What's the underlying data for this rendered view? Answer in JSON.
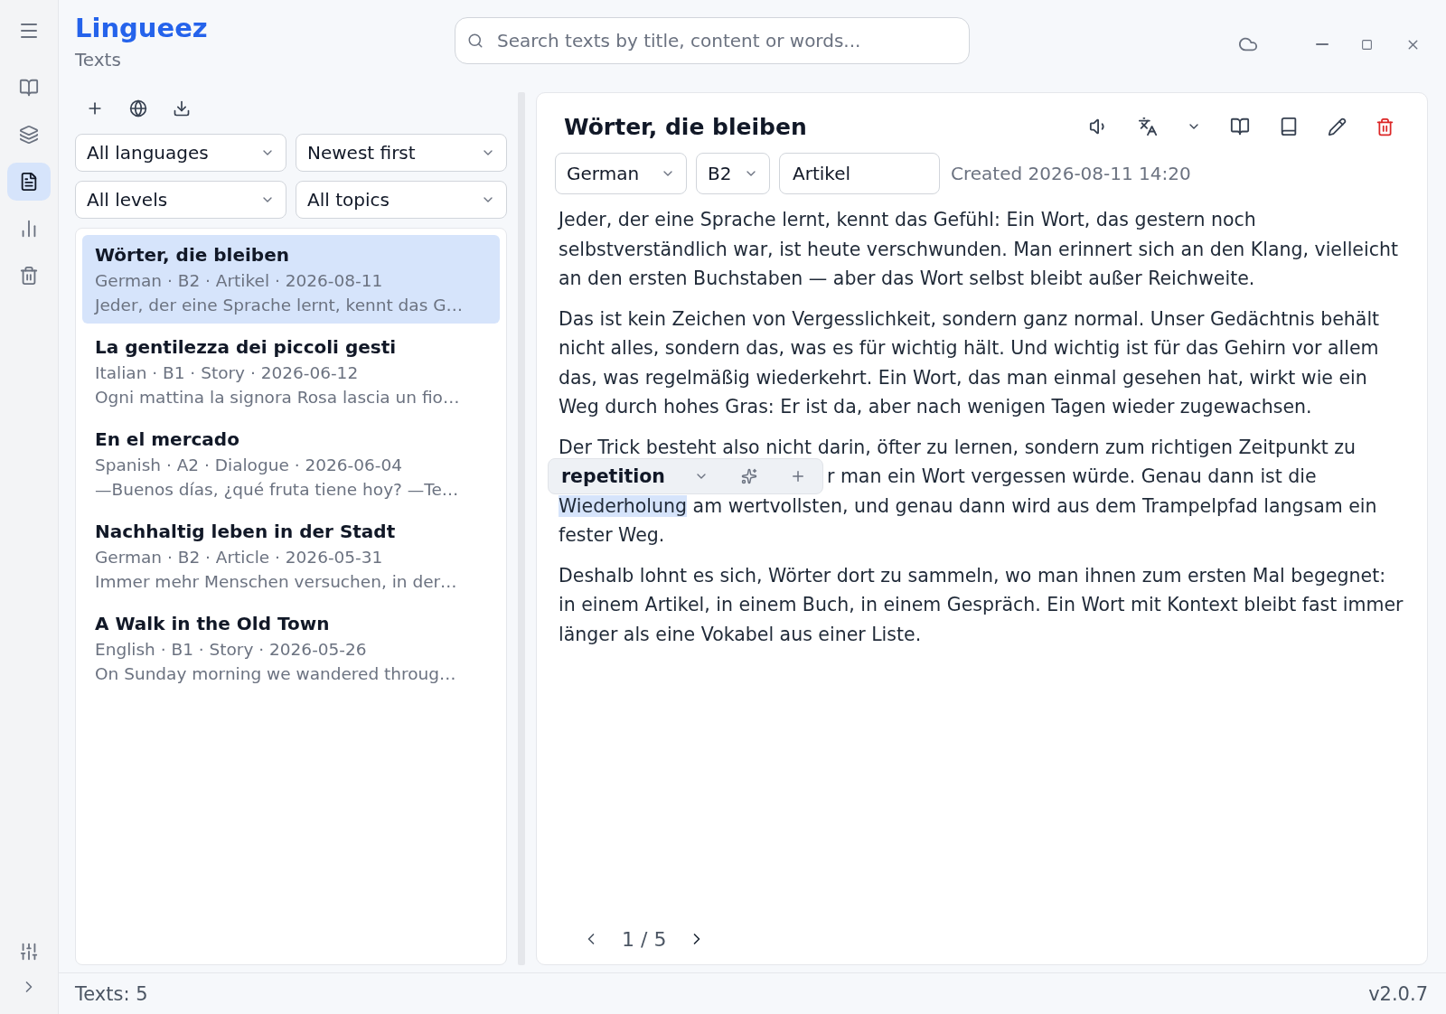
{
  "app": {
    "name": "Lingueez",
    "section": "Texts"
  },
  "nav": [
    {
      "selected": false
    },
    {
      "selected": false
    },
    {
      "selected": true
    },
    {
      "selected": false
    },
    {
      "selected": false
    }
  ],
  "search": {
    "placeholder": "Search texts by title, content or words..."
  },
  "filters": [
    "All languages",
    "Newest first",
    "All levels",
    "All topics"
  ],
  "texts": [
    {
      "title": "Wörter, die bleiben",
      "meta": "German · B2 · Artikel · 2026-08-11",
      "snippet": "Jeder, der eine Sprache lernt, kennt das G…",
      "selected": true
    },
    {
      "title": "La gentilezza dei piccoli gesti",
      "meta": "Italian · B1 · Story · 2026-06-12",
      "snippet": "Ogni mattina la signora Rosa lascia un fio…",
      "selected": false
    },
    {
      "title": "En el mercado",
      "meta": "Spanish · A2 · Dialogue · 2026-06-04",
      "snippet": "—Buenos días, ¿qué fruta tiene hoy? —Te…",
      "selected": false
    },
    {
      "title": "Nachhaltig leben in der Stadt",
      "meta": "German · B2 · Article · 2026-05-31",
      "snippet": "Immer mehr Menschen versuchen, in der…",
      "selected": false
    },
    {
      "title": "A Walk in the Old Town",
      "meta": "English · B1 · Story · 2026-05-26",
      "snippet": "On Sunday morning we wandered throug…",
      "selected": false
    }
  ],
  "reader": {
    "title": "Wörter, die bleiben",
    "language": "German",
    "level": "B2",
    "topic": "Artikel",
    "created": "Created 2026-08-11 14:20",
    "paragraphs": [
      {
        "kind": "plain",
        "text": "Jeder, der eine Sprache lernt, kennt das Gefühl: Ein Wort, das gestern noch selbstverständlich war, ist heute verschwunden. Man erinnert sich an den Klang, vielleicht an den ersten Buchstaben — aber das Wort selbst bleibt außer Reichweite."
      },
      {
        "kind": "plain",
        "text": "Das ist kein Zeichen von Vergesslichkeit, sondern ganz normal. Unser Gedächtnis behält nicht alles, sondern das, was es für wichtig hält. Und wichtig ist für das Gehirn vor allem das, was regelmäßig wiederkehrt. Ein Wort, das man einmal gesehen hat, wirkt wie ein Weg durch hohes Gras: Er ist da, aber nach wenigen Tagen wieder zugewachsen."
      },
      {
        "kind": "selection",
        "before": "Der Trick besteht also nicht darin, öfter zu lernen, sondern zum richtigen Zeitpunkt zu",
        "after": "r man ein Wort vergessen würde. Genau dann ist die",
        "highlight": "Wiederholung",
        "end": "am wertvollsten, und genau dann wird aus dem Trampelpfad langsam ein fester Weg.",
        "translation": "repetition"
      },
      {
        "kind": "plain",
        "text": "Deshalb lohnt es sich, Wörter dort zu sammeln, wo man ihnen zum ersten Mal begegnet: in einem Artikel, in einem Buch, in einem Gespräch. Ein Wort mit Kontext bleibt fast immer länger als eine Vokabel aus einer Liste."
      }
    ],
    "page": "1 / 5"
  },
  "status": {
    "count": "Texts: 5",
    "version": "v2.0.7"
  }
}
